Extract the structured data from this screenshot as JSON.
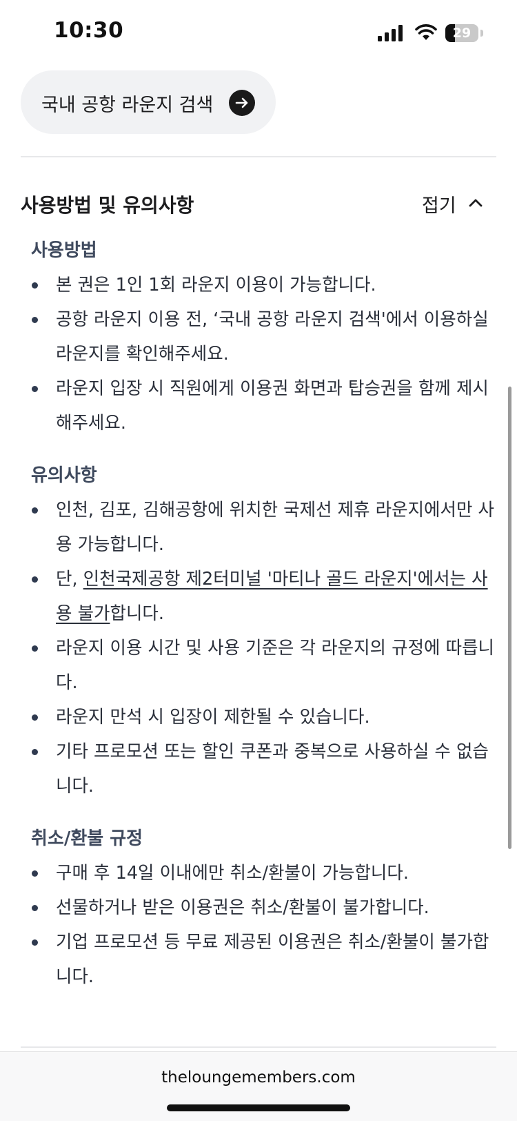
{
  "status_bar": {
    "time": "10:30",
    "battery": "29",
    "battery_level": 0.29
  },
  "search_button": {
    "label": "국내 공항 라운지 검색"
  },
  "section": {
    "title": "사용방법 및 유의사항",
    "collapse_label": "접기"
  },
  "usage": {
    "heading": "사용방법",
    "items": [
      "본 권은 1인 1회 라운지 이용이 가능합니다.",
      "공항 라운지 이용 전, ‘국내 공항 라운지 검색'에서 이용하실 라운지를 확인해주세요.",
      "라운지 입장 시 직원에게 이용권 화면과 탑승권을 함께 제시해주세요."
    ]
  },
  "notes": {
    "heading": "유의사항",
    "item1": "인천, 김포, 김해공항에 위치한 국제선 제휴 라운지에서만 사용 가능합니다.",
    "item2_prefix": "단, ",
    "item2_underlined": "인천국제공항 제2터미널 '마티나 골드 라운지'에서는 사용 불가",
    "item2_suffix": "합니다.",
    "item3": "라운지 이용 시간 및 사용 기준은 각 라운지의 규정에 따릅니다.",
    "item4": "라운지 만석 시 입장이 제한될 수 있습니다.",
    "item5": "기타 프로모션 또는 할인 쿠폰과 중복으로 사용하실 수 없습니다."
  },
  "refund": {
    "heading": "취소/환불 규정",
    "items": [
      "구매 후 14일 이내에만 취소/환불이 가능합니다.",
      "선물하거나 받은 이용권은 취소/환불이 불가합니다.",
      "기업 프로모션 등 무료 제공된 이용권은 취소/환불이 불가합니다."
    ]
  },
  "browser": {
    "url": "theloungemembers.com"
  }
}
